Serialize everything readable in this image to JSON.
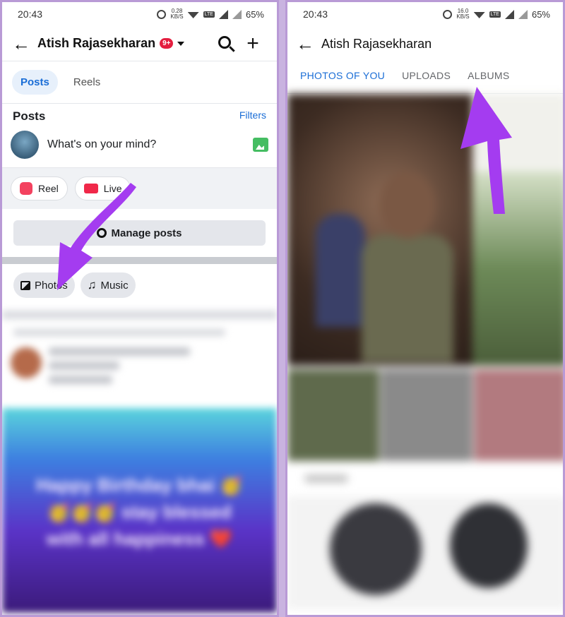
{
  "status_left": {
    "time": "20:43",
    "speed": "0.28",
    "speed_unit": "KB/S",
    "battery": "65%"
  },
  "status_right": {
    "time": "20:43",
    "speed": "16.0",
    "speed_unit": "KB/S",
    "battery": "65%"
  },
  "left": {
    "header": {
      "name": "Atish Rajasekharan",
      "badge": "9+"
    },
    "pills": [
      "Posts",
      "Reels"
    ],
    "posts_title": "Posts",
    "filters": "Filters",
    "composer_placeholder": "What's on your mind?",
    "chips": {
      "reel": "Reel",
      "live": "Live"
    },
    "manage_posts": "Manage posts",
    "media": {
      "photos": "Photos",
      "music": "Music"
    },
    "bday_text": "Happy Birthday bhai 🥳 🥳🥳🥳 stay blessed with all happiness ❤️"
  },
  "right": {
    "header": {
      "name": "Atish Rajasekharan"
    },
    "tabs": [
      "PHOTOS OF YOU",
      "UPLOADS",
      "ALBUMS"
    ]
  },
  "colors": {
    "accent": "#1a6dd6",
    "arrow": "#a43cf0",
    "frame": "#b99ad6"
  },
  "icons": [
    "back-arrow-icon",
    "search-icon",
    "plus-icon",
    "gallery-icon",
    "reel-icon",
    "live-icon",
    "gear-icon",
    "photo-icon",
    "music-icon"
  ]
}
